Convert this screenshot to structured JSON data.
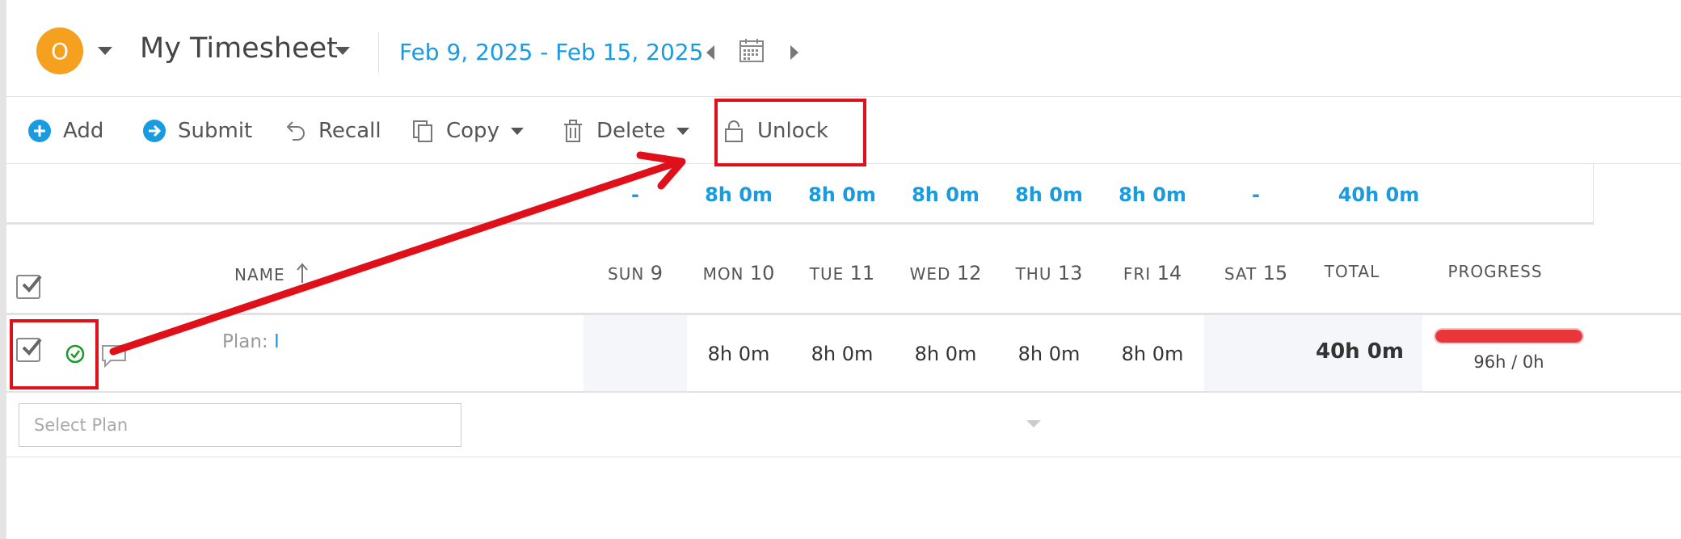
{
  "header": {
    "avatar_initial": "O",
    "title": "My Timesheet",
    "date_range": "Feb 9, 2025 - Feb 15, 2025"
  },
  "toolbar": {
    "add_label": "Add",
    "submit_label": "Submit",
    "recall_label": "Recall",
    "copy_label": "Copy",
    "delete_label": "Delete",
    "unlock_label": "Unlock"
  },
  "totals": {
    "sun": "-",
    "mon": "8h 0m",
    "tue": "8h 0m",
    "wed": "8h 0m",
    "thu": "8h 0m",
    "fri": "8h 0m",
    "sat": "-",
    "total": "40h 0m"
  },
  "columns": {
    "name": "NAME",
    "sun": {
      "day": "SUN",
      "num": "9"
    },
    "mon": {
      "day": "MON",
      "num": "10"
    },
    "tue": {
      "day": "TUE",
      "num": "11"
    },
    "wed": {
      "day": "WED",
      "num": "12"
    },
    "thu": {
      "day": "THU",
      "num": "13"
    },
    "fri": {
      "day": "FRI",
      "num": "14"
    },
    "sat": {
      "day": "SAT",
      "num": "15"
    },
    "total": "TOTAL",
    "progress": "PROGRESS"
  },
  "row": {
    "plan_prefix": "Plan: ",
    "plan_value": "I",
    "mon": "8h 0m",
    "tue": "8h 0m",
    "wed": "8h 0m",
    "thu": "8h 0m",
    "fri": "8h 0m",
    "total": "40h 0m",
    "progress_text": "96h / 0h",
    "progress_fraction": 1.0
  },
  "select_plan": {
    "placeholder": "Select Plan"
  },
  "colors": {
    "accent": "#1a9be0",
    "avatar": "#f5a01e",
    "progress_over": "#e8363b",
    "status_ok": "#1a9a2a",
    "annotation": "#e0101a"
  }
}
